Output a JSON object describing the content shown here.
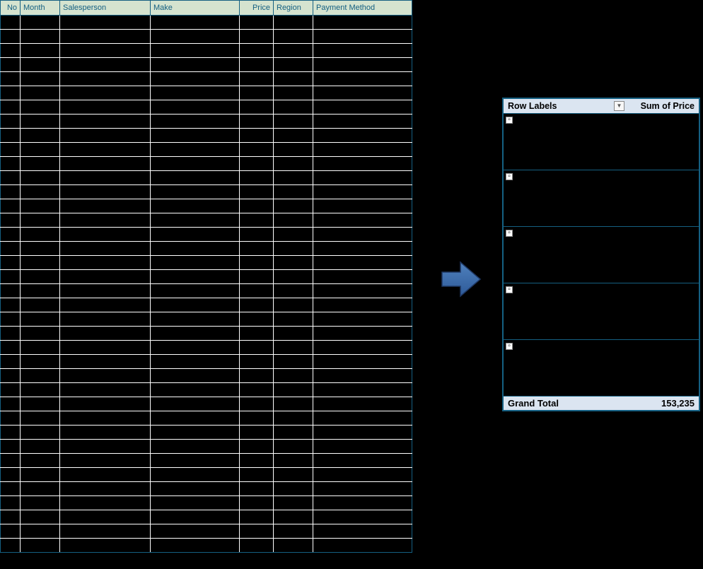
{
  "data_table": {
    "headers": [
      "No",
      "Month",
      "Salesperson",
      "Make",
      "Price",
      "Region",
      "Payment Method"
    ],
    "row_count": 38
  },
  "pivot": {
    "header_label": "Row Labels",
    "header_sum": "Sum of Price",
    "dropdown_glyph": "▼",
    "collapse_glyph": "▫",
    "groups": [
      {
        "sub_rows": 3
      },
      {
        "sub_rows": 3
      },
      {
        "sub_rows": 3
      },
      {
        "sub_rows": 3
      },
      {
        "sub_rows": 3
      }
    ],
    "grand_label": "Grand Total",
    "grand_value": "153,235"
  }
}
